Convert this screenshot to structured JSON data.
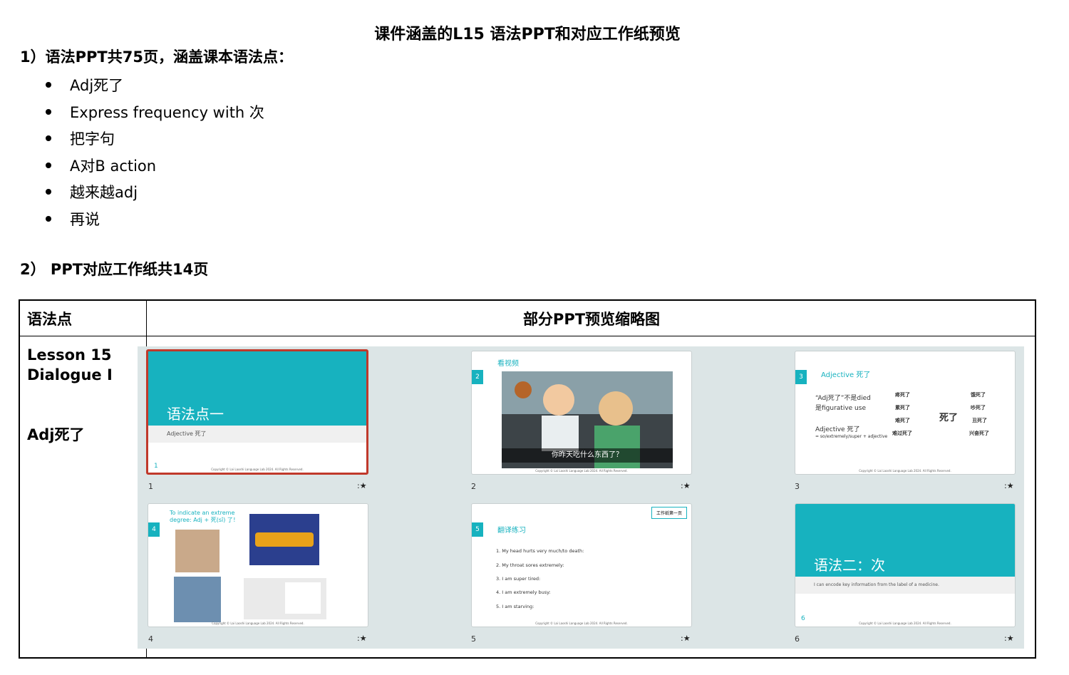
{
  "title": "课件涵盖的L15 语法PPT和对应工作纸预览",
  "section1": "1）语法PPT共75页，涵盖课本语法点：",
  "bullets": [
    "Adj死了",
    "Express frequency with 次",
    "把字句",
    "A对B action",
    "越来越adj",
    "再说"
  ],
  "section2": "2） PPT对应工作纸共14页",
  "table": {
    "col1_header": "语法点",
    "col2_header": "部分PPT预览缩略图",
    "lesson_line1": "Lesson 15",
    "lesson_line2": "Dialogue I",
    "grammar_point": "Adj死了"
  },
  "slides": [
    {
      "num": "1",
      "title": "语法点一",
      "subtitle": "Adjective 死了",
      "page": "1"
    },
    {
      "num": "2",
      "title": "看视频",
      "caption": "你昨天吃什么东西了？"
    },
    {
      "num": "3",
      "title": "Adjective 死了",
      "line1": "“Adj死了”不是died",
      "line2": "是figurative use",
      "line3": "Adjective 死了",
      "line4": "= so/extremely/super + adjective",
      "words_left": [
        "疼死了",
        "累死了",
        "难死了",
        "难过死了"
      ],
      "words_right": [
        "饿死了",
        "吵死了",
        "丑死了",
        "兴奋死了"
      ],
      "center": "死了"
    },
    {
      "num": "4",
      "title": "To indicate an extreme degree: Adj + 死(sǐ) 了！"
    },
    {
      "num": "5",
      "title": "翻译练习",
      "tag": "工作纸第一页",
      "items": [
        "1.   My head hurts very much/to death:",
        "2.   My throat sores extremely:",
        "3.   I am super tired:",
        "4.   I am extremely busy:",
        "5.   I am starving:"
      ]
    },
    {
      "num": "6",
      "title": "语法二：次",
      "subtitle": "I can encode key information from the label of a medicine.",
      "page": "6"
    }
  ],
  "star_label": ":★",
  "copyright": "Copyright © Lai Laoshi Language Lab 2024. All Rights Reserved.",
  "colors": {
    "teal": "#17b2bf",
    "selected_border": "#c0392b",
    "grid_bg": "#dce5e6"
  }
}
